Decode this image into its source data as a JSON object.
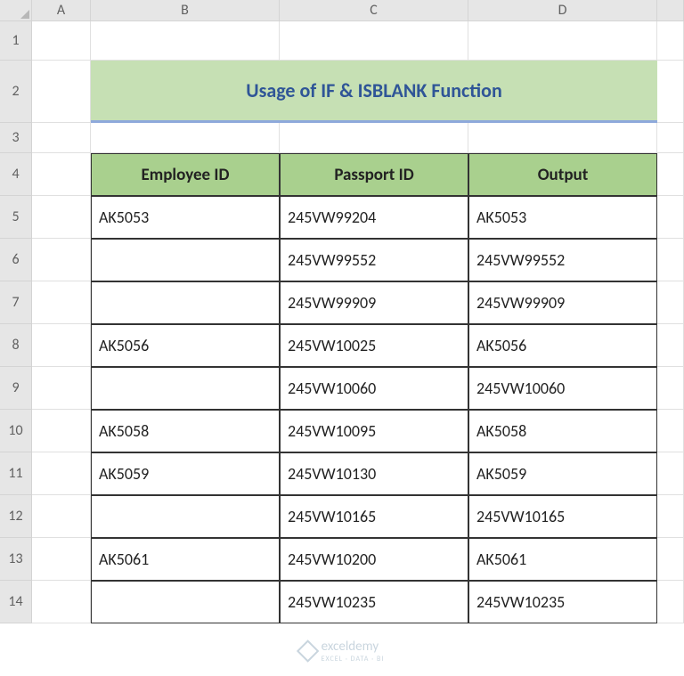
{
  "columns": [
    "A",
    "B",
    "C",
    "D"
  ],
  "rows": [
    "1",
    "2",
    "3",
    "4",
    "5",
    "6",
    "7",
    "8",
    "9",
    "10",
    "11",
    "12",
    "13",
    "14"
  ],
  "title": "Usage of IF & ISBLANK Function",
  "headers": {
    "b": "Employee ID",
    "c": "Passport ID",
    "d": "Output"
  },
  "data": [
    {
      "emp": "AK5053",
      "pass": "245VW99204",
      "out": "AK5053"
    },
    {
      "emp": "",
      "pass": "245VW99552",
      "out": "245VW99552"
    },
    {
      "emp": "",
      "pass": "245VW99909",
      "out": "245VW99909"
    },
    {
      "emp": "AK5056",
      "pass": "245VW10025",
      "out": "AK5056"
    },
    {
      "emp": "",
      "pass": "245VW10060",
      "out": "245VW10060"
    },
    {
      "emp": "AK5058",
      "pass": "245VW10095",
      "out": "AK5058"
    },
    {
      "emp": "AK5059",
      "pass": "245VW10130",
      "out": "AK5059"
    },
    {
      "emp": "",
      "pass": "245VW10165",
      "out": "245VW10165"
    },
    {
      "emp": "AK5061",
      "pass": "245VW10200",
      "out": "AK5061"
    },
    {
      "emp": "",
      "pass": "245VW10235",
      "out": "245VW10235"
    }
  ],
  "watermark": {
    "brand": "exceldemy",
    "tag": "EXCEL · DATA · BI"
  }
}
